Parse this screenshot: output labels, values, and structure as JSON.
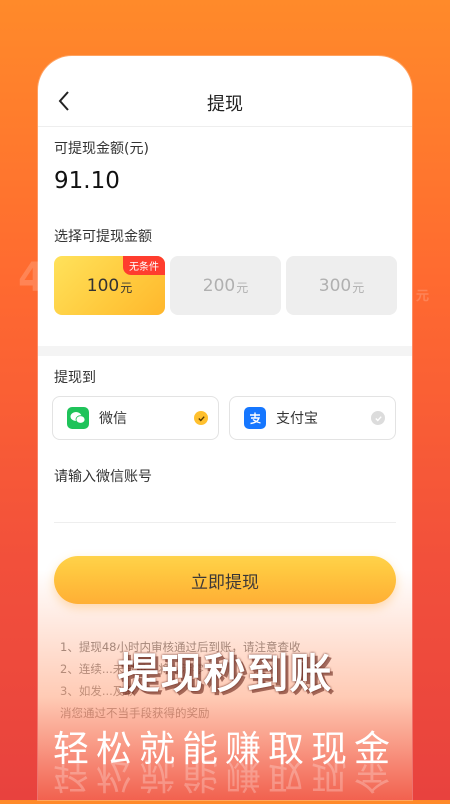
{
  "nav": {
    "title": "提现"
  },
  "balance": {
    "label": "可提现金额(元)",
    "value": "91.10"
  },
  "select": {
    "label": "选择可提现金额",
    "options": [
      {
        "amount": "100",
        "unit": "元",
        "badge": "无条件",
        "selected": true
      },
      {
        "amount": "200",
        "unit": "元",
        "selected": false
      },
      {
        "amount": "300",
        "unit": "元",
        "selected": false
      }
    ]
  },
  "withdraw_to": {
    "label": "提现到",
    "methods": [
      {
        "name": "微信",
        "icon": "wechat-icon",
        "checked": true
      },
      {
        "name": "支付宝",
        "icon": "alipay-icon",
        "checked": false
      }
    ]
  },
  "account": {
    "label": "请输入微信账号",
    "placeholder": ""
  },
  "submit": {
    "label": "立即提现"
  },
  "notes": [
    "1、提现48小时内审核通过后到账，请注意查收",
    "2、连续...未登录...将...清零",
    "3、如发...及取",
    "消您通过不当手段获得的奖励"
  ],
  "promo": {
    "headline": "提现秒到账",
    "subline": "轻松就能赚取现金"
  },
  "colors": {
    "accent": "#ffb72d",
    "badge": "#ff3d2e",
    "wechat": "#1fc35a",
    "alipay": "#1677ff"
  }
}
